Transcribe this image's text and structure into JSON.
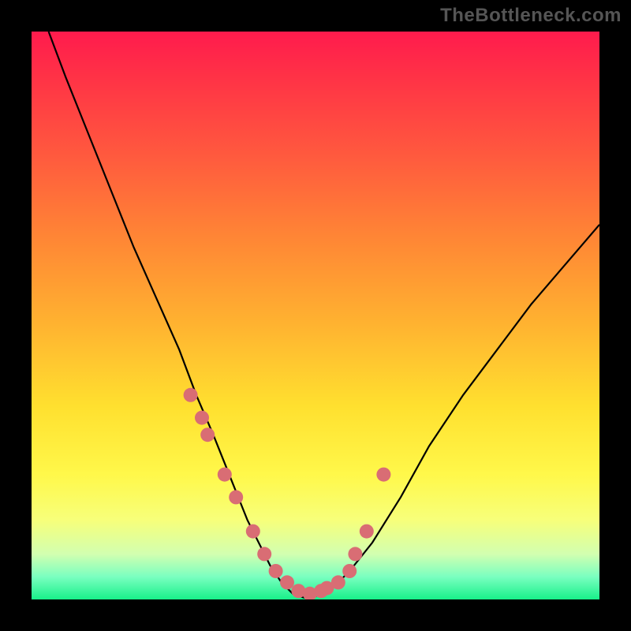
{
  "watermark": "TheBottleneck.com",
  "chart_data": {
    "type": "line",
    "title": "",
    "xlabel": "",
    "ylabel": "",
    "xlim": [
      0,
      100
    ],
    "ylim": [
      0,
      100
    ],
    "grid": false,
    "legend": false,
    "series": [
      {
        "name": "bottleneck-curve",
        "x": [
          3,
          6,
          10,
          14,
          18,
          22,
          26,
          29,
          32,
          34,
          36,
          38,
          40,
          42,
          44,
          46,
          48,
          50,
          53,
          56,
          60,
          65,
          70,
          76,
          82,
          88,
          94,
          100
        ],
        "y": [
          100,
          92,
          82,
          72,
          62,
          53,
          44,
          36,
          29,
          24,
          19,
          14,
          10,
          6,
          3,
          1,
          0.3,
          0.6,
          2,
          5,
          10,
          18,
          27,
          36,
          44,
          52,
          59,
          66
        ]
      }
    ],
    "markers": {
      "name": "highlight-dots",
      "note": "dots along the curve near the bottom of the V",
      "x": [
        28,
        30,
        31,
        34,
        36,
        39,
        41,
        43,
        45,
        47,
        49,
        51,
        52,
        54,
        56,
        57,
        59,
        62
      ],
      "y": [
        36,
        32,
        29,
        22,
        18,
        12,
        8,
        5,
        3,
        1.5,
        1,
        1.5,
        2,
        3,
        5,
        8,
        12,
        22
      ]
    },
    "background_gradient": {
      "top_color": "#ff1b4d",
      "bottom_color": "#18f08a",
      "stops": [
        "red",
        "orange",
        "yellow",
        "green"
      ]
    }
  }
}
